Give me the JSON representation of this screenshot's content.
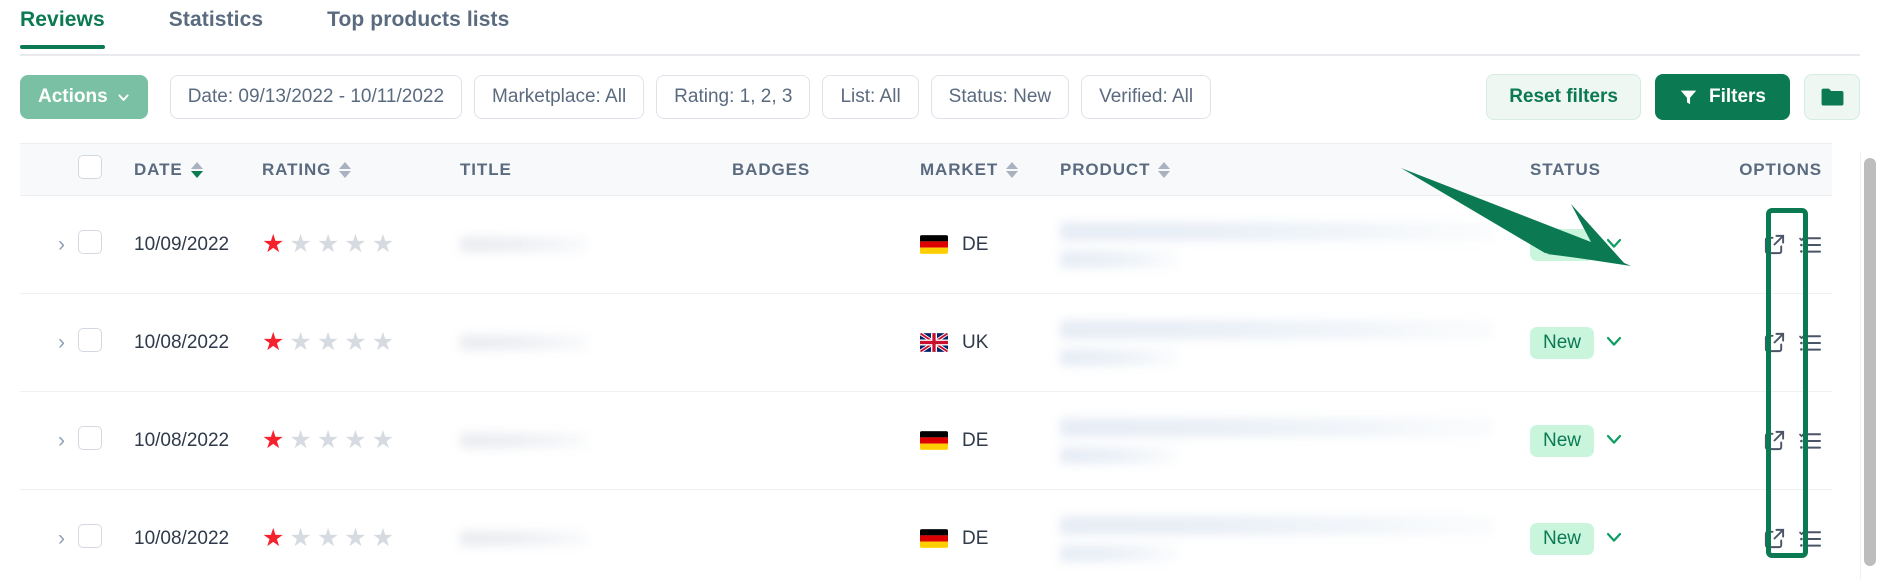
{
  "tabs": [
    {
      "label": "Reviews",
      "active": true
    },
    {
      "label": "Statistics",
      "active": false
    },
    {
      "label": "Top products lists",
      "active": false
    }
  ],
  "toolbar": {
    "actions_label": "Actions",
    "chips": [
      {
        "label": "Date: 09/13/2022 - 10/11/2022",
        "name": "filter-chip-date"
      },
      {
        "label": "Marketplace: All",
        "name": "filter-chip-marketplace"
      },
      {
        "label": "Rating: 1, 2, 3",
        "name": "filter-chip-rating"
      },
      {
        "label": "List: All",
        "name": "filter-chip-list"
      },
      {
        "label": "Status: New",
        "name": "filter-chip-status"
      },
      {
        "label": "Verified: All",
        "name": "filter-chip-verified"
      }
    ],
    "reset_label": "Reset filters",
    "filters_label": "Filters",
    "folder_icon": "folder-icon",
    "filter_icon": "funnel-icon"
  },
  "table": {
    "columns": [
      {
        "label": "DATE",
        "sortable": true,
        "sort": "desc"
      },
      {
        "label": "RATING",
        "sortable": true,
        "sort": "none"
      },
      {
        "label": "TITLE",
        "sortable": false
      },
      {
        "label": "BADGES",
        "sortable": false
      },
      {
        "label": "MARKET",
        "sortable": true,
        "sort": "none"
      },
      {
        "label": "PRODUCT",
        "sortable": true,
        "sort": "none"
      },
      {
        "label": "STATUS",
        "sortable": false
      },
      {
        "label": "OPTIONS",
        "sortable": false
      }
    ],
    "rows": [
      {
        "date": "10/09/2022",
        "rating": 1,
        "market_code": "DE",
        "market_flag": "flag-de",
        "status": "New"
      },
      {
        "date": "10/08/2022",
        "rating": 1,
        "market_code": "UK",
        "market_flag": "flag-uk",
        "status": "New"
      },
      {
        "date": "10/08/2022",
        "rating": 1,
        "market_code": "DE",
        "market_flag": "flag-de",
        "status": "New"
      },
      {
        "date": "10/08/2022",
        "rating": 1,
        "market_code": "DE",
        "market_flag": "flag-de",
        "status": "New"
      }
    ],
    "max_stars": 5,
    "row_icons": {
      "open": "external-link-icon",
      "checklist": "checklist-icon",
      "expand": "chevron-right-icon"
    }
  },
  "annotations": {
    "arrow": "green-pointer-arrow",
    "highlight": "green-highlight-box-options-checklist"
  },
  "colors": {
    "accent": "#0b7a52",
    "actions_button": "#79c0a4",
    "badge_bg": "#c9f5dd",
    "star_active": "#f5222d",
    "star_inactive": "#d6dae1"
  }
}
